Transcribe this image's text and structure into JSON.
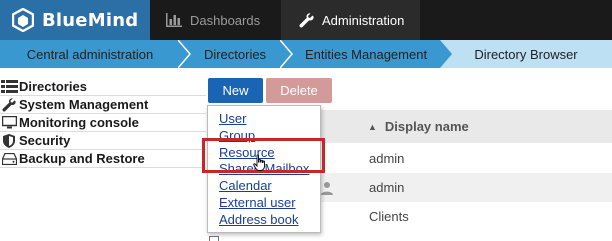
{
  "app": {
    "name": "BlueMind"
  },
  "topnav": {
    "dashboards": {
      "label": "Dashboards",
      "icon": "bar-chart-icon"
    },
    "administration": {
      "label": "Administration",
      "icon": "wrench-icon"
    }
  },
  "breadcrumb": [
    "Central administration",
    "Directories",
    "Entities Management",
    "Directory Browser"
  ],
  "sidebar": {
    "items": [
      {
        "label": "Directories",
        "icon": "list-icon"
      },
      {
        "label": "System Management",
        "icon": "wrench-icon"
      },
      {
        "label": "Monitoring console",
        "icon": "monitor-icon"
      },
      {
        "label": "Security",
        "icon": "shield-icon"
      },
      {
        "label": "Backup and Restore",
        "icon": "drive-icon"
      }
    ]
  },
  "toolbar": {
    "new_label": "New",
    "delete_label": "Delete"
  },
  "table": {
    "header": "Display name",
    "rows": [
      "admin",
      "admin",
      "Clients"
    ]
  },
  "dropdown": {
    "items": [
      "User",
      "Group",
      "Resource",
      "Shared Mailbox",
      "Calendar",
      "External user",
      "Address book"
    ],
    "highlighted": "Resource"
  },
  "colors": {
    "brand": "#2a6fa6",
    "breadcrumb": "#3a98d0",
    "primary_button": "#1a64b6",
    "delete_button": "#d49a9a",
    "highlight": "#c62828",
    "link": "#1a3e9a"
  }
}
